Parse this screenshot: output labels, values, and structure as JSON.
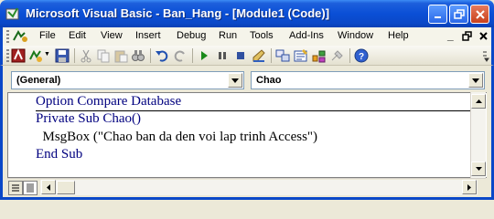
{
  "window": {
    "title": "Microsoft Visual Basic - Ban_Hang - [Module1 (Code)]",
    "minimize_icon": "minimize-icon",
    "maximize_icon": "maximize-icon",
    "close_icon": "close-icon",
    "titlebar_color": "#0a48c8"
  },
  "menu": {
    "items": [
      "File",
      "Edit",
      "View",
      "Insert",
      "Debug",
      "Run",
      "Tools",
      "Add-Ins",
      "Window",
      "Help"
    ],
    "right_controls": [
      "_",
      "̸",
      "x"
    ]
  },
  "toolbar": {
    "icons": [
      "access-icon",
      "insert-module-icon",
      "save-icon",
      "cut-icon",
      "copy-icon",
      "paste-icon",
      "find-icon",
      "undo-icon",
      "redo-icon",
      "run-icon",
      "break-icon",
      "reset-icon",
      "design-mode-icon",
      "project-explorer-icon",
      "properties-icon",
      "object-browser-icon",
      "toolbox-icon",
      "help-icon"
    ]
  },
  "combos": {
    "object": "(General)",
    "procedure": "Chao"
  },
  "code": {
    "lines": [
      "Option Compare Database",
      "Private Sub Chao()",
      "  MsgBox (\"Chao ban da den voi lap trinh Access\")",
      "End Sub"
    ],
    "keyword_color": "#00007f"
  }
}
